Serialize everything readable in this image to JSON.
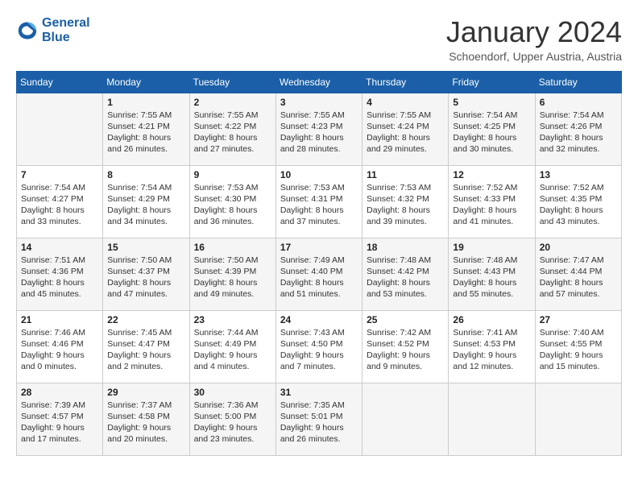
{
  "header": {
    "logo_line1": "General",
    "logo_line2": "Blue",
    "month_year": "January 2024",
    "location": "Schoendorf, Upper Austria, Austria"
  },
  "weekdays": [
    "Sunday",
    "Monday",
    "Tuesday",
    "Wednesday",
    "Thursday",
    "Friday",
    "Saturday"
  ],
  "weeks": [
    [
      {
        "day": "",
        "sunrise": "",
        "sunset": "",
        "daylight": ""
      },
      {
        "day": "1",
        "sunrise": "Sunrise: 7:55 AM",
        "sunset": "Sunset: 4:21 PM",
        "daylight": "Daylight: 8 hours and 26 minutes."
      },
      {
        "day": "2",
        "sunrise": "Sunrise: 7:55 AM",
        "sunset": "Sunset: 4:22 PM",
        "daylight": "Daylight: 8 hours and 27 minutes."
      },
      {
        "day": "3",
        "sunrise": "Sunrise: 7:55 AM",
        "sunset": "Sunset: 4:23 PM",
        "daylight": "Daylight: 8 hours and 28 minutes."
      },
      {
        "day": "4",
        "sunrise": "Sunrise: 7:55 AM",
        "sunset": "Sunset: 4:24 PM",
        "daylight": "Daylight: 8 hours and 29 minutes."
      },
      {
        "day": "5",
        "sunrise": "Sunrise: 7:54 AM",
        "sunset": "Sunset: 4:25 PM",
        "daylight": "Daylight: 8 hours and 30 minutes."
      },
      {
        "day": "6",
        "sunrise": "Sunrise: 7:54 AM",
        "sunset": "Sunset: 4:26 PM",
        "daylight": "Daylight: 8 hours and 32 minutes."
      }
    ],
    [
      {
        "day": "7",
        "sunrise": "Sunrise: 7:54 AM",
        "sunset": "Sunset: 4:27 PM",
        "daylight": "Daylight: 8 hours and 33 minutes."
      },
      {
        "day": "8",
        "sunrise": "Sunrise: 7:54 AM",
        "sunset": "Sunset: 4:29 PM",
        "daylight": "Daylight: 8 hours and 34 minutes."
      },
      {
        "day": "9",
        "sunrise": "Sunrise: 7:53 AM",
        "sunset": "Sunset: 4:30 PM",
        "daylight": "Daylight: 8 hours and 36 minutes."
      },
      {
        "day": "10",
        "sunrise": "Sunrise: 7:53 AM",
        "sunset": "Sunset: 4:31 PM",
        "daylight": "Daylight: 8 hours and 37 minutes."
      },
      {
        "day": "11",
        "sunrise": "Sunrise: 7:53 AM",
        "sunset": "Sunset: 4:32 PM",
        "daylight": "Daylight: 8 hours and 39 minutes."
      },
      {
        "day": "12",
        "sunrise": "Sunrise: 7:52 AM",
        "sunset": "Sunset: 4:33 PM",
        "daylight": "Daylight: 8 hours and 41 minutes."
      },
      {
        "day": "13",
        "sunrise": "Sunrise: 7:52 AM",
        "sunset": "Sunset: 4:35 PM",
        "daylight": "Daylight: 8 hours and 43 minutes."
      }
    ],
    [
      {
        "day": "14",
        "sunrise": "Sunrise: 7:51 AM",
        "sunset": "Sunset: 4:36 PM",
        "daylight": "Daylight: 8 hours and 45 minutes."
      },
      {
        "day": "15",
        "sunrise": "Sunrise: 7:50 AM",
        "sunset": "Sunset: 4:37 PM",
        "daylight": "Daylight: 8 hours and 47 minutes."
      },
      {
        "day": "16",
        "sunrise": "Sunrise: 7:50 AM",
        "sunset": "Sunset: 4:39 PM",
        "daylight": "Daylight: 8 hours and 49 minutes."
      },
      {
        "day": "17",
        "sunrise": "Sunrise: 7:49 AM",
        "sunset": "Sunset: 4:40 PM",
        "daylight": "Daylight: 8 hours and 51 minutes."
      },
      {
        "day": "18",
        "sunrise": "Sunrise: 7:48 AM",
        "sunset": "Sunset: 4:42 PM",
        "daylight": "Daylight: 8 hours and 53 minutes."
      },
      {
        "day": "19",
        "sunrise": "Sunrise: 7:48 AM",
        "sunset": "Sunset: 4:43 PM",
        "daylight": "Daylight: 8 hours and 55 minutes."
      },
      {
        "day": "20",
        "sunrise": "Sunrise: 7:47 AM",
        "sunset": "Sunset: 4:44 PM",
        "daylight": "Daylight: 8 hours and 57 minutes."
      }
    ],
    [
      {
        "day": "21",
        "sunrise": "Sunrise: 7:46 AM",
        "sunset": "Sunset: 4:46 PM",
        "daylight": "Daylight: 9 hours and 0 minutes."
      },
      {
        "day": "22",
        "sunrise": "Sunrise: 7:45 AM",
        "sunset": "Sunset: 4:47 PM",
        "daylight": "Daylight: 9 hours and 2 minutes."
      },
      {
        "day": "23",
        "sunrise": "Sunrise: 7:44 AM",
        "sunset": "Sunset: 4:49 PM",
        "daylight": "Daylight: 9 hours and 4 minutes."
      },
      {
        "day": "24",
        "sunrise": "Sunrise: 7:43 AM",
        "sunset": "Sunset: 4:50 PM",
        "daylight": "Daylight: 9 hours and 7 minutes."
      },
      {
        "day": "25",
        "sunrise": "Sunrise: 7:42 AM",
        "sunset": "Sunset: 4:52 PM",
        "daylight": "Daylight: 9 hours and 9 minutes."
      },
      {
        "day": "26",
        "sunrise": "Sunrise: 7:41 AM",
        "sunset": "Sunset: 4:53 PM",
        "daylight": "Daylight: 9 hours and 12 minutes."
      },
      {
        "day": "27",
        "sunrise": "Sunrise: 7:40 AM",
        "sunset": "Sunset: 4:55 PM",
        "daylight": "Daylight: 9 hours and 15 minutes."
      }
    ],
    [
      {
        "day": "28",
        "sunrise": "Sunrise: 7:39 AM",
        "sunset": "Sunset: 4:57 PM",
        "daylight": "Daylight: 9 hours and 17 minutes."
      },
      {
        "day": "29",
        "sunrise": "Sunrise: 7:37 AM",
        "sunset": "Sunset: 4:58 PM",
        "daylight": "Daylight: 9 hours and 20 minutes."
      },
      {
        "day": "30",
        "sunrise": "Sunrise: 7:36 AM",
        "sunset": "Sunset: 5:00 PM",
        "daylight": "Daylight: 9 hours and 23 minutes."
      },
      {
        "day": "31",
        "sunrise": "Sunrise: 7:35 AM",
        "sunset": "Sunset: 5:01 PM",
        "daylight": "Daylight: 9 hours and 26 minutes."
      },
      {
        "day": "",
        "sunrise": "",
        "sunset": "",
        "daylight": ""
      },
      {
        "day": "",
        "sunrise": "",
        "sunset": "",
        "daylight": ""
      },
      {
        "day": "",
        "sunrise": "",
        "sunset": "",
        "daylight": ""
      }
    ]
  ]
}
